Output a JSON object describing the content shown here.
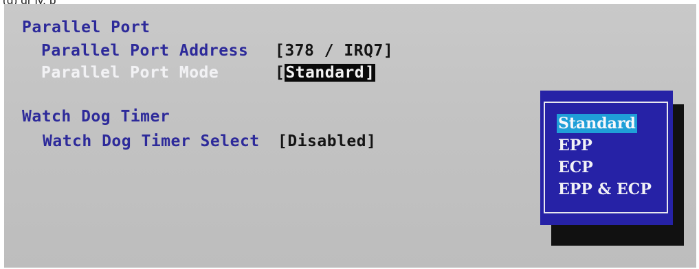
{
  "caption": "(g)                                                  gr             ly,           p",
  "sections": {
    "parallel_port": {
      "heading": "Parallel Port",
      "address_label": "Parallel Port Address",
      "address_value": "[378 / IRQ7]",
      "mode_label": "Parallel Port Mode",
      "mode_open": "[",
      "mode_value": "Standard",
      "mode_close": "]"
    },
    "watchdog": {
      "heading": "Watch Dog Timer",
      "select_label": "Watch Dog Timer Select",
      "select_value": "[Disabled]"
    }
  },
  "popup": {
    "options": [
      "Standard",
      "EPP",
      "ECP",
      "EPP & ECP"
    ],
    "selected_index": 0
  },
  "colors": {
    "background": "#c4c4c4",
    "heading_text": "#2d2a9a",
    "popup_bg": "#2622a6",
    "popup_highlight": "#1f9fd8",
    "value_text": "#141414"
  }
}
